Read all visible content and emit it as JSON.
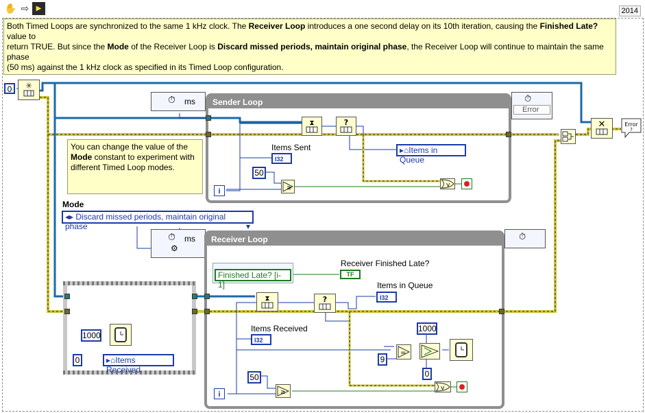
{
  "toolbar": {
    "year": "2014"
  },
  "note_top": {
    "lines": [
      [
        {
          "t": "Both Timed Loops are synchronized to the same 1 kHz clock. The ",
          "b": false
        },
        {
          "t": "Receiver Loop",
          "b": true
        },
        {
          "t": " introduces a one second delay on its 10th iteration, causing the ",
          "b": false
        },
        {
          "t": "Finished Late?",
          "b": true
        },
        {
          "t": " value to",
          "b": false
        }
      ],
      [
        {
          "t": "return TRUE. But since the ",
          "b": false
        },
        {
          "t": "Mode",
          "b": true
        },
        {
          "t": " of the Receiver Loop is ",
          "b": false
        },
        {
          "t": "Discard missed periods, maintain original phase",
          "b": true
        },
        {
          "t": ", the Receiver Loop will continue to maintain the same phase",
          "b": false
        }
      ],
      [
        {
          "t": "(50 ms) against the 1 kHz clock as specified in its Timed Loop configuration.",
          "b": false
        }
      ]
    ]
  },
  "note_mode": {
    "lines": [
      [
        {
          "t": "You can change the value of the",
          "b": false
        }
      ],
      [
        {
          "t": "Mode",
          "b": true
        },
        {
          "t": " constant to experiment with",
          "b": false
        }
      ],
      [
        {
          "t": "different Timed Loop modes.",
          "b": false
        }
      ]
    ]
  },
  "consts": {
    "zero_left": "0",
    "fifty_sender": "50",
    "fifty_receiver": "50",
    "thousand_left": "1000",
    "zero_items": "0",
    "nine": "9",
    "thousand_right": "1000",
    "zero_select": "0"
  },
  "sender": {
    "title": "Sender Loop",
    "timing_unit": "ms",
    "error_label": "Error",
    "items_sent_label": "Items Sent",
    "items_in_queue": "Items in Queue",
    "i32": "I32",
    "iter": "i"
  },
  "mode": {
    "label": "Mode",
    "value": "Discard missed periods, maintain original phase"
  },
  "receiver": {
    "title": "Receiver Loop",
    "timing_unit": "ms",
    "finished_late_node": "Finished Late? [i-1]",
    "finished_late_label": "Receiver Finished Late?",
    "tf": "TF",
    "items_in_queue_label": "Items in Queue",
    "items_received_label": "Items Received",
    "i32": "I32",
    "iter": "i"
  },
  "flat": {
    "items_received": "Items Received"
  },
  "icons": {
    "hand": "hand-icon",
    "arrow": "run-arrow-icon",
    "stop_flag": "stop-flag-icon",
    "error_bubble": "Error ?"
  },
  "colors": {
    "wire_error": "#cfc43a",
    "wire_ref": "#1a6aa8",
    "wire_num": "#1a3aa8",
    "wire_bool": "#1f7a1f",
    "loop_frame": "#8f8f8f",
    "note_bg": "#ffffc8"
  }
}
